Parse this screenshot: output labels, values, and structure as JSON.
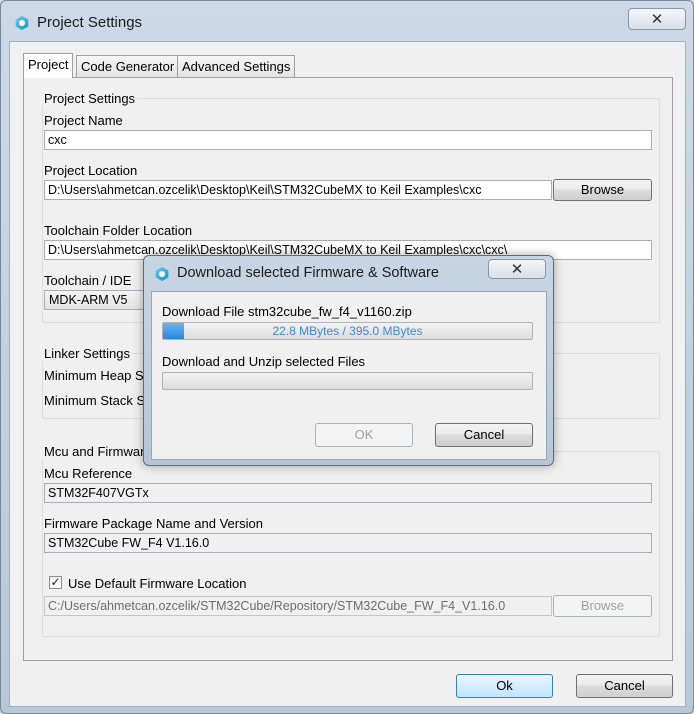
{
  "window": {
    "title": "Project Settings",
    "close_glyph": "✕"
  },
  "tabs": [
    {
      "label": "Project",
      "active": true
    },
    {
      "label": "Code Generator",
      "active": false
    },
    {
      "label": "Advanced Settings",
      "active": false
    }
  ],
  "project_settings": {
    "group_title": "Project Settings",
    "name_label": "Project Name",
    "name_value": "cxc",
    "location_label": "Project Location",
    "location_value": "D:\\Users\\ahmetcan.ozcelik\\Desktop\\Keil\\STM32CubeMX to Keil Examples\\cxc",
    "browse_label": "Browse",
    "toolchain_folder_label": "Toolchain Folder Location",
    "toolchain_folder_value": "D:\\Users\\ahmetcan.ozcelik\\Desktop\\Keil\\STM32CubeMX to Keil Examples\\cxc\\cxc\\",
    "toolchain_label": "Toolchain / IDE",
    "toolchain_value": "MDK-ARM V5"
  },
  "linker_settings": {
    "group_title": "Linker Settings",
    "min_heap_label": "Minimum Heap Si",
    "min_stack_label": "Minimum Stack S"
  },
  "mcu_firmware": {
    "group_title": "Mcu and Firmwar",
    "mcu_ref_label": "Mcu Reference",
    "mcu_ref_value": "STM32F407VGTx",
    "fw_pkg_label": "Firmware Package Name and Version",
    "fw_pkg_value": "STM32Cube FW_F4 V1.16.0",
    "use_default_label": "Use Default Firmware Location",
    "use_default_checked": true,
    "check_glyph": "✓",
    "fw_location_value": "C:/Users/ahmetcan.ozcelik/STM32Cube/Repository/STM32Cube_FW_F4_V1.16.0",
    "browse_label": "Browse"
  },
  "footer": {
    "ok_label": "Ok",
    "cancel_label": "Cancel"
  },
  "download_dialog": {
    "title": "Download selected Firmware & Software",
    "close_glyph": "✕",
    "file_label": "Download File stm32cube_fw_f4_v1160.zip",
    "progress_text": "22.8 MBytes / 395.0 MBytes",
    "progress_fraction": 0.058,
    "unzip_label": "Download and Unzip selected Files",
    "unzip_fraction": 0.0,
    "ok_label": "OK",
    "cancel_label": "Cancel"
  }
}
